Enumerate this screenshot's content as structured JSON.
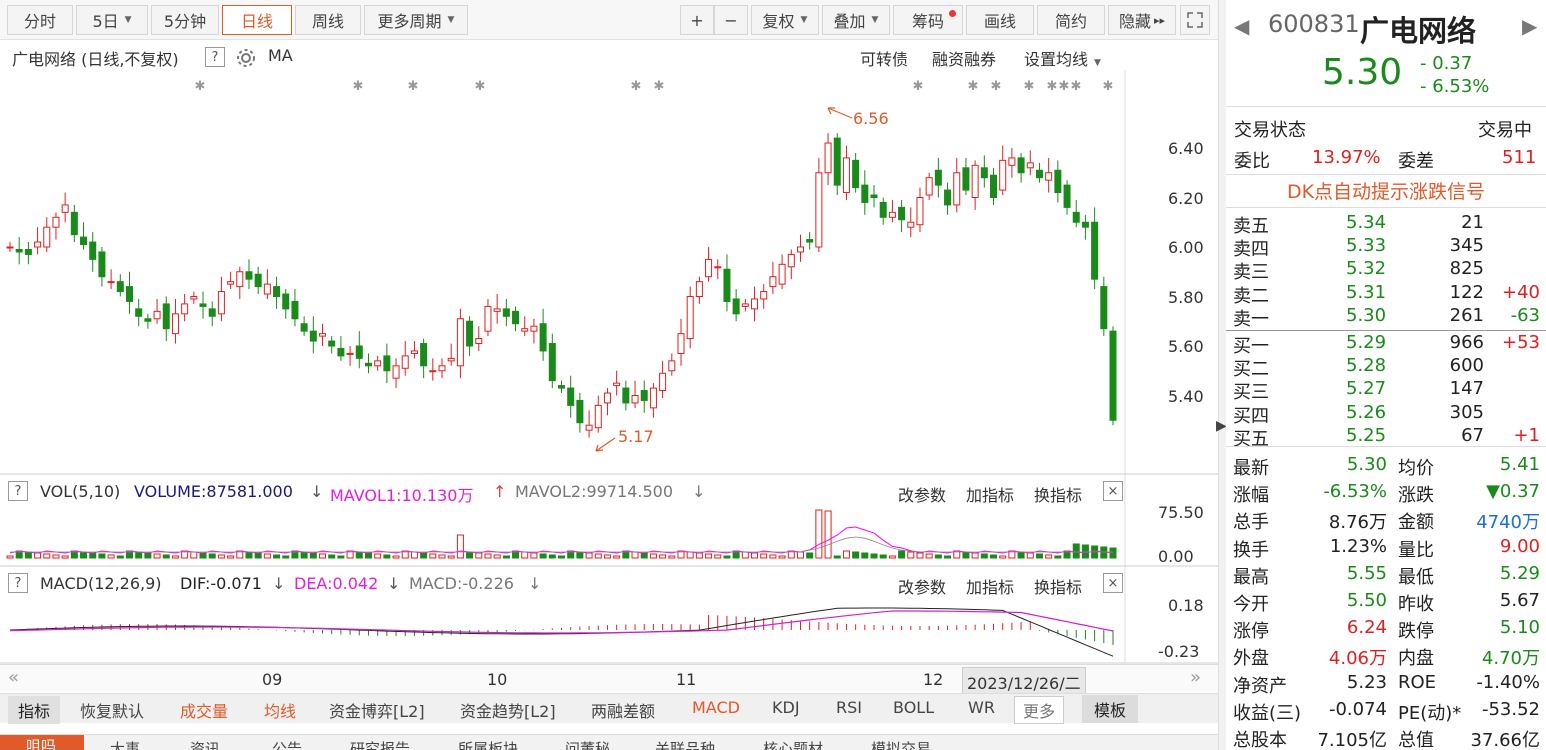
{
  "toolbar": {
    "buttons": [
      {
        "label": "分时"
      },
      {
        "label": "5日"
      },
      {
        "label": "5分钟"
      },
      {
        "label": "日线"
      },
      {
        "label": "周线"
      },
      {
        "label": "更多周期"
      }
    ],
    "right": [
      {
        "label": "+"
      },
      {
        "label": "−"
      },
      {
        "label": "复权"
      },
      {
        "label": "叠加"
      },
      {
        "label": "筹码"
      },
      {
        "label": "画线"
      },
      {
        "label": "简约"
      },
      {
        "label": "隐藏"
      }
    ],
    "hide_arrows": "▸▸"
  },
  "chart_header": {
    "title": "广电网络 (日线,不复权)",
    "help": "?",
    "ma": "MA",
    "links": [
      "可转债",
      "融资融券",
      "设置均线"
    ]
  },
  "price_axis": [
    "6.40",
    "6.20",
    "6.00",
    "5.80",
    "5.60",
    "5.40"
  ],
  "annotations": {
    "high": "6.56",
    "low": "5.17"
  },
  "vol_panel": {
    "help": "?",
    "name": "VOL(5,10)",
    "volume": "VOLUME:87581.000",
    "mavol1": "MAVOL1:10.130万",
    "mavol2": "MAVOL2:99714.500",
    "arrow_down": "↓",
    "arrow_up": "↑",
    "axis": [
      "75.50",
      "0.00"
    ],
    "links": [
      "改参数",
      "加指标",
      "换指标"
    ],
    "close": "×"
  },
  "macd_panel": {
    "help": "?",
    "name": "MACD(12,26,9)",
    "dif": "DIF:-0.071",
    "dea": "DEA:0.042",
    "macd": "MACD:-0.226",
    "arrow_down": "↓",
    "axis": [
      "0.18",
      "-0.23"
    ],
    "links": [
      "改参数",
      "加指标",
      "换指标"
    ],
    "close": "×"
  },
  "x_axis": {
    "months": [
      "09",
      "10",
      "11",
      "12"
    ],
    "date": "2023/12/26/二"
  },
  "indicator_tabs": [
    "指标",
    "恢复默认",
    "成交量",
    "均线",
    "资金博弈[L2]",
    "资金趋势[L2]",
    "两融差额",
    "MACD",
    "KDJ",
    "RSI",
    "BOLL",
    "WR",
    "更多",
    "模板"
  ],
  "lower_tabs": [
    "咀吗",
    "大事",
    "资讯",
    "公告",
    "研究报告",
    "所属板块",
    "问董秘",
    "关联品种",
    "核心题材",
    "模拟交易"
  ],
  "stock": {
    "code": "600831",
    "name": "广电网络",
    "price": "5.30",
    "change": "- 0.37",
    "pct": "- 6.53%"
  },
  "status": {
    "label": "交易状态",
    "value": "交易中"
  },
  "weibi": {
    "label1": "委比",
    "value1": "13.97%",
    "label2": "委差",
    "value2": "511"
  },
  "dk_signal": "DK点自动提示涨跌信号",
  "sell": [
    {
      "label": "卖五",
      "price": "5.34",
      "vol": "21",
      "chg": ""
    },
    {
      "label": "卖四",
      "price": "5.33",
      "vol": "345",
      "chg": ""
    },
    {
      "label": "卖三",
      "price": "5.32",
      "vol": "825",
      "chg": ""
    },
    {
      "label": "卖二",
      "price": "5.31",
      "vol": "122",
      "chg": "+40"
    },
    {
      "label": "卖一",
      "price": "5.30",
      "vol": "261",
      "chg": "-63"
    }
  ],
  "buy": [
    {
      "label": "买一",
      "price": "5.29",
      "vol": "966",
      "chg": "+53"
    },
    {
      "label": "买二",
      "price": "5.28",
      "vol": "600",
      "chg": ""
    },
    {
      "label": "买三",
      "price": "5.27",
      "vol": "147",
      "chg": ""
    },
    {
      "label": "买四",
      "price": "5.26",
      "vol": "305",
      "chg": ""
    },
    {
      "label": "买五",
      "price": "5.25",
      "vol": "67",
      "chg": "+1"
    }
  ],
  "quotes": [
    {
      "l1": "最新",
      "v1": "5.30",
      "c1": "green",
      "l2": "均价",
      "v2": "5.41",
      "c2": "green"
    },
    {
      "l1": "涨幅",
      "v1": "-6.53%",
      "c1": "green",
      "l2": "涨跌",
      "v2": "▼0.37",
      "c2": "green"
    },
    {
      "l1": "总手",
      "v1": "8.76万",
      "c1": "dark",
      "l2": "金额",
      "v2": "4740万",
      "c2": "blue"
    },
    {
      "l1": "换手",
      "v1": "1.23%",
      "c1": "dark",
      "l2": "量比",
      "v2": "9.00",
      "c2": "red"
    },
    {
      "l1": "最高",
      "v1": "5.55",
      "c1": "green",
      "l2": "最低",
      "v2": "5.29",
      "c2": "green"
    },
    {
      "l1": "今开",
      "v1": "5.50",
      "c1": "green",
      "l2": "昨收",
      "v2": "5.67",
      "c2": "dark"
    },
    {
      "l1": "涨停",
      "v1": "6.24",
      "c1": "red",
      "l2": "跌停",
      "v2": "5.10",
      "c2": "green"
    },
    {
      "l1": "外盘",
      "v1": "4.06万",
      "c1": "red",
      "l2": "内盘",
      "v2": "4.70万",
      "c2": "green"
    },
    {
      "l1": "净资产",
      "v1": "5.23",
      "c1": "dark",
      "l2": "ROE",
      "v2": "-1.40%",
      "c2": "dark"
    },
    {
      "l1": "收益(三)",
      "v1": "-0.074",
      "c1": "dark",
      "l2": "PE(动)*",
      "v2": "-53.52",
      "c2": "dark"
    },
    {
      "l1": "总股本",
      "v1": "7.105亿",
      "c1": "dark",
      "l2": "总值",
      "v2": "37.66亿",
      "c2": "dark"
    }
  ],
  "colors": {
    "up": "#e02020",
    "down": "#1a8a1a",
    "accent": "#e05a2a",
    "ma1": "#ff00ff"
  },
  "icons": [
    "gear-icon",
    "fullscreen-icon",
    "prev-arrow-icon",
    "next-arrow-icon",
    "collapse-arrow-icon",
    "scroll-left-icon",
    "scroll-right-icon"
  ]
}
